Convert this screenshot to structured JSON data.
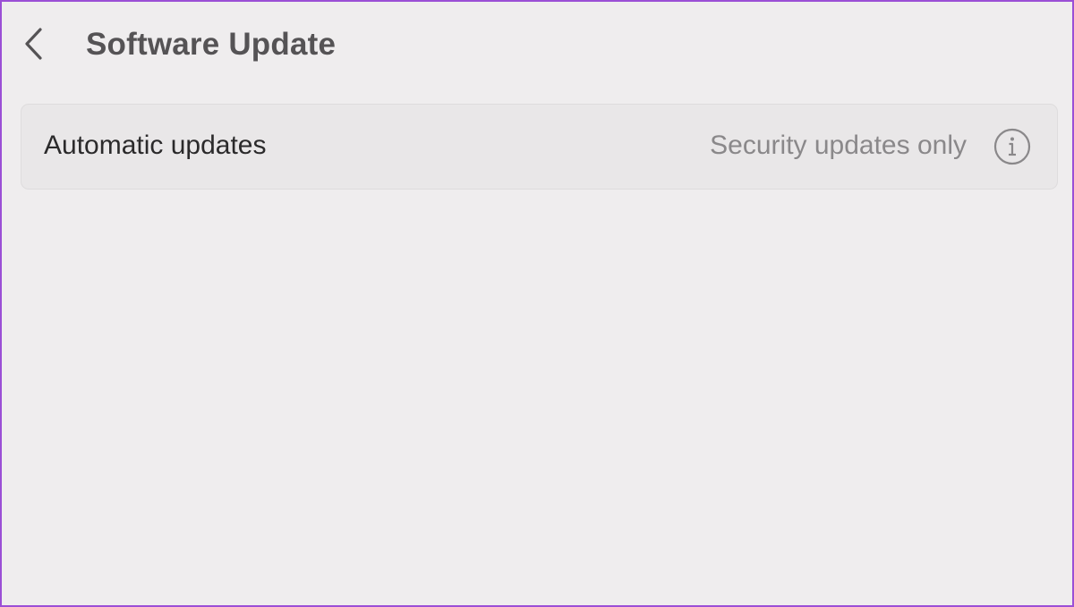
{
  "header": {
    "back_icon": "chevron-left-icon",
    "title": "Software Update"
  },
  "settings": {
    "automatic_updates": {
      "label": "Automatic updates",
      "value": "Security updates only",
      "info_icon": "info-circle-icon"
    }
  },
  "colors": {
    "background": "#efedee",
    "card_background": "#e9e7e8",
    "title_text": "#555355",
    "label_text": "#2b2a2b",
    "value_text": "#8a888a",
    "frame_border": "#9b4fd6"
  }
}
